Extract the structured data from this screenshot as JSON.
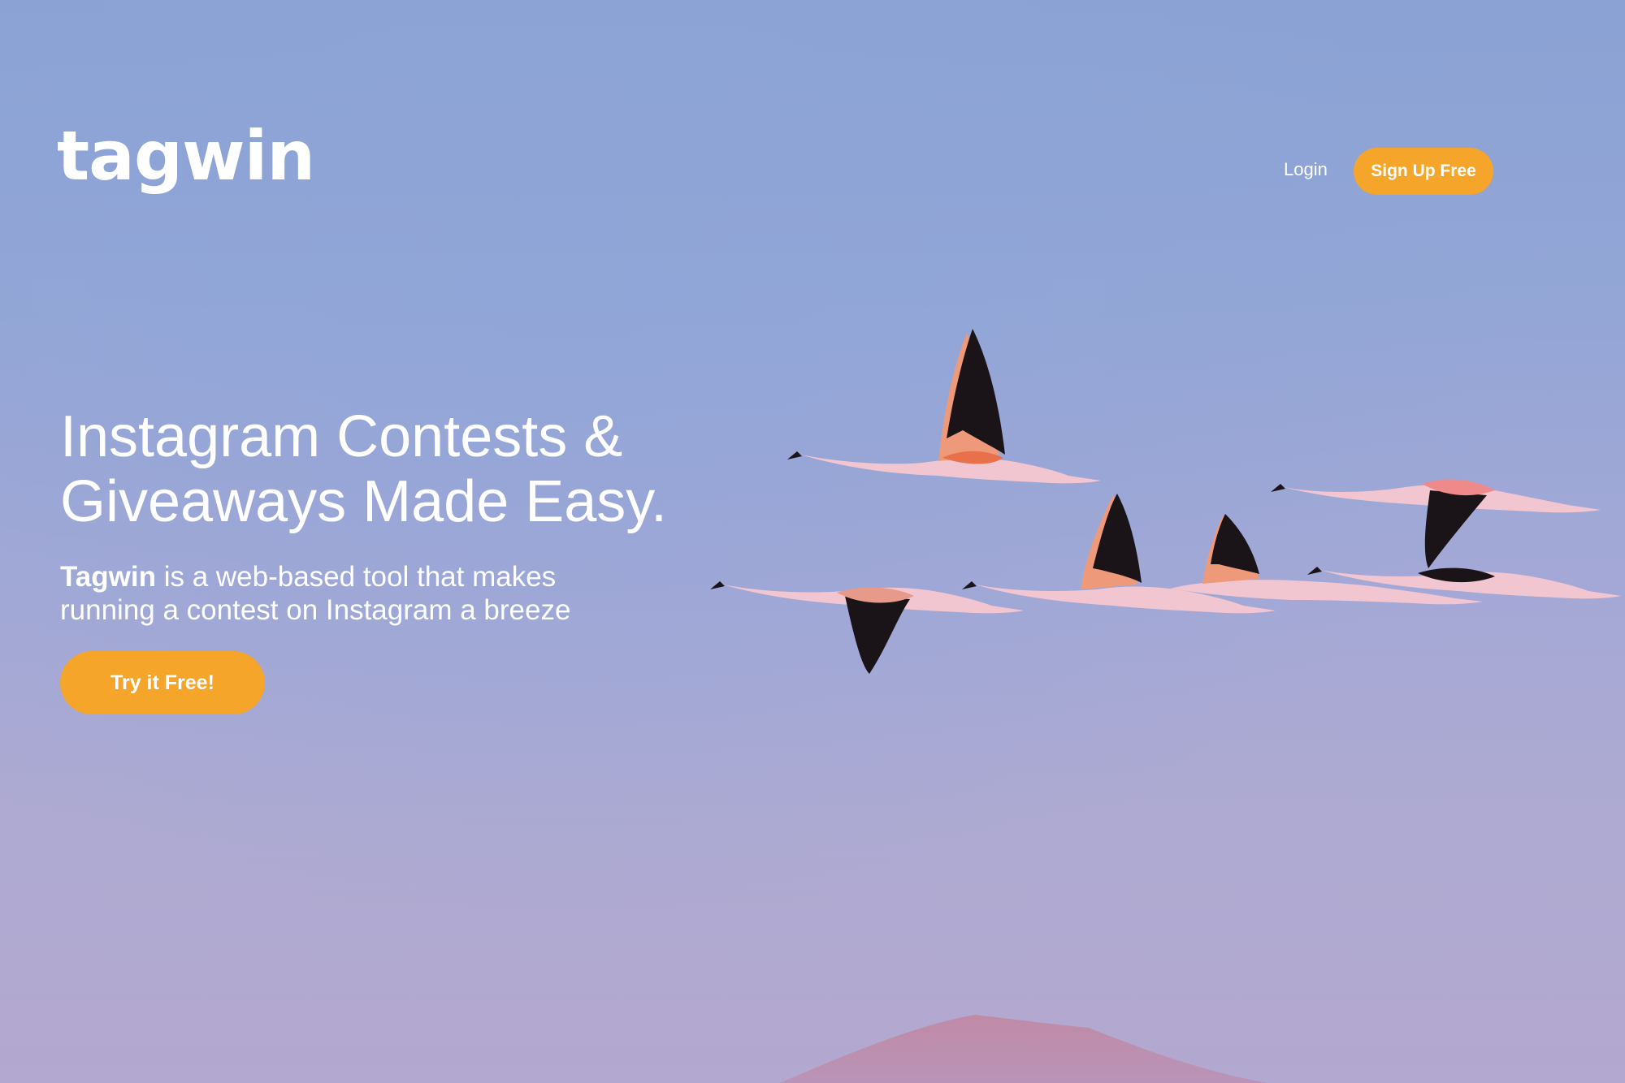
{
  "header": {
    "logo_text": "tagwin",
    "login_label": "Login",
    "signup_label": "Sign Up Free"
  },
  "hero": {
    "headline_line1": "Instagram Contests &",
    "headline_line2": "Giveaways Made Easy.",
    "subtext_brand": "Tagwin",
    "subtext_rest_line1": " is a web-based tool that makes",
    "subtext_line2": "running a contest on Instagram a breeze",
    "cta_label": "Try it Free!"
  },
  "colors": {
    "accent": "#f5a52a",
    "sky_top": "#8aa2d4",
    "sky_bottom": "#b3a8cf",
    "mountain": "#c08aa6",
    "flamingo_body": "#f2c6d0",
    "flamingo_wing": "#e8704a",
    "flamingo_flight_feathers": "#1a1418"
  },
  "background": {
    "subject": "flock-of-flamingos-in-flight",
    "flamingo_count": 6
  }
}
